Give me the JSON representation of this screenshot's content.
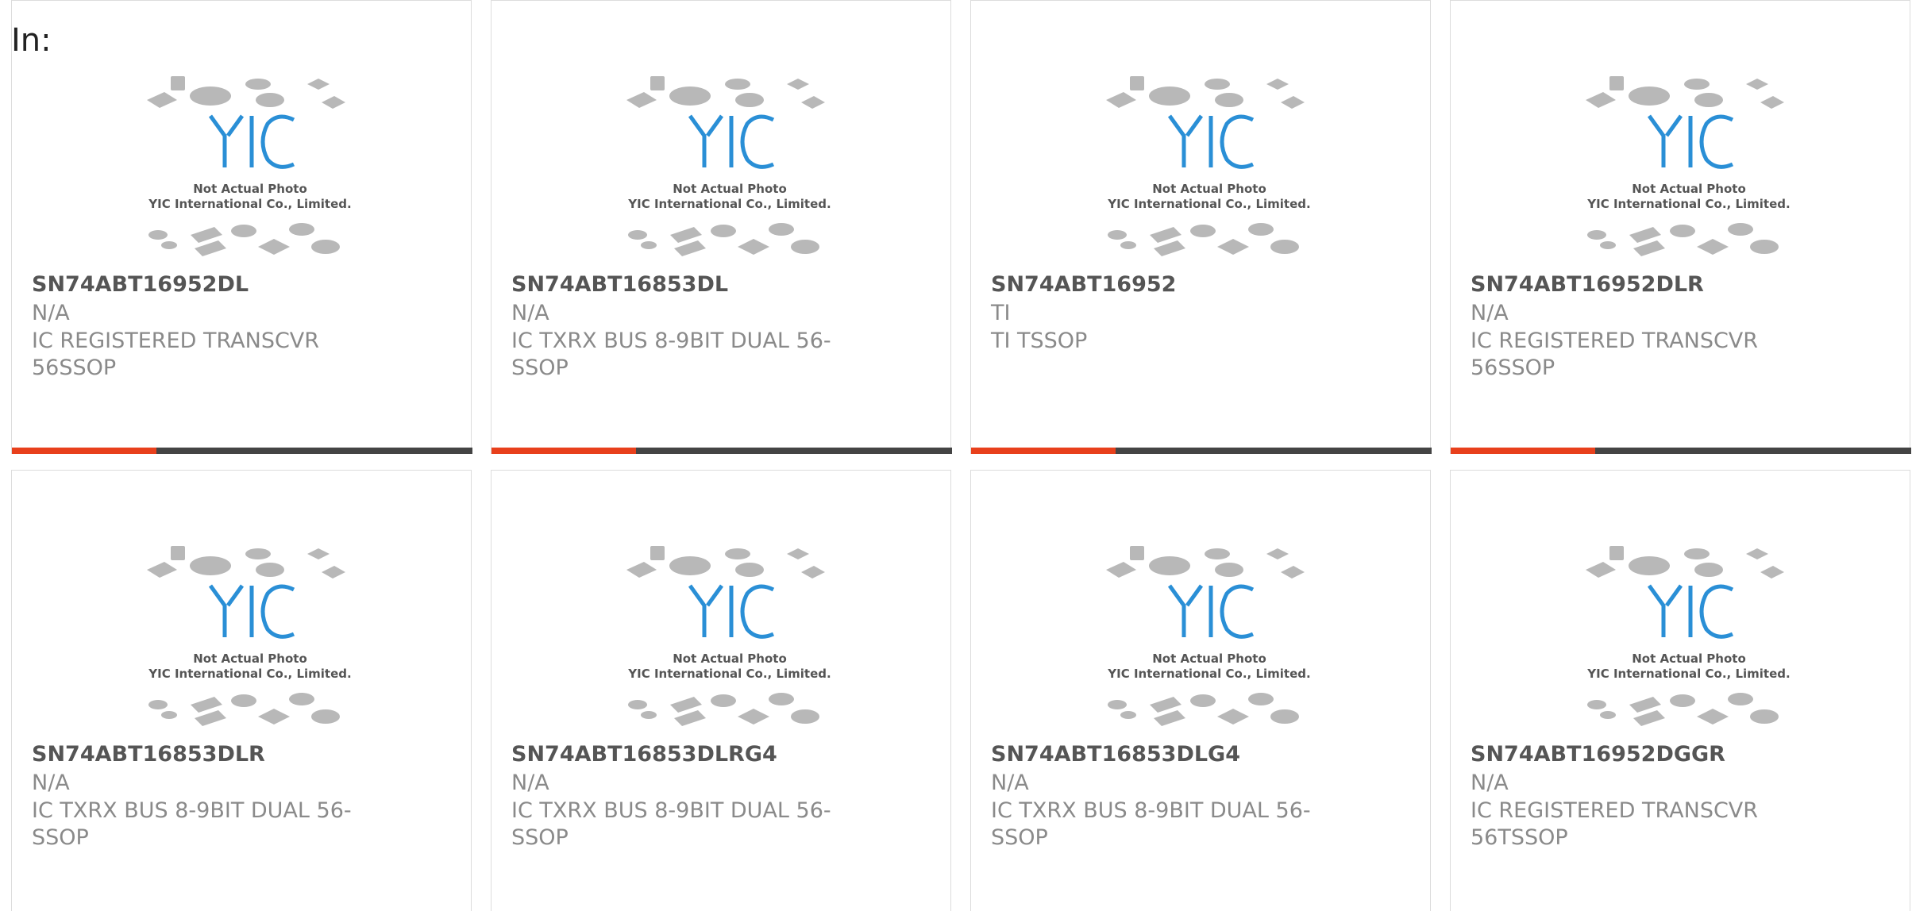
{
  "header": {
    "label": "In:"
  },
  "placeholder": {
    "line1": "Not Actual Photo",
    "line2": "YIC International Co., Limited.",
    "logo": "YIC"
  },
  "colors": {
    "accent": "#e8401c",
    "bar_dark": "#444444",
    "logo_blue": "#2a8fd6"
  },
  "products": [
    {
      "part_number": "SN74ABT16952DL",
      "manufacturer": "N/A",
      "description": "IC REGISTERED TRANSCVR 56SSOP"
    },
    {
      "part_number": "SN74ABT16853DL",
      "manufacturer": "N/A",
      "description": "IC TXRX BUS 8-9BIT DUAL 56-SSOP"
    },
    {
      "part_number": "SN74ABT16952",
      "manufacturer": "TI",
      "description": "TI TSSOP"
    },
    {
      "part_number": "SN74ABT16952DLR",
      "manufacturer": "N/A",
      "description": "IC REGISTERED TRANSCVR 56SSOP"
    },
    {
      "part_number": "SN74ABT16853DLR",
      "manufacturer": "N/A",
      "description": "IC TXRX BUS 8-9BIT DUAL 56-SSOP"
    },
    {
      "part_number": "SN74ABT16853DLRG4",
      "manufacturer": "N/A",
      "description": "IC TXRX BUS 8-9BIT DUAL 56-SSOP"
    },
    {
      "part_number": "SN74ABT16853DLG4",
      "manufacturer": "N/A",
      "description": "IC TXRX BUS 8-9BIT DUAL 56-SSOP"
    },
    {
      "part_number": "SN74ABT16952DGGR",
      "manufacturer": "N/A",
      "description": "IC REGISTERED TRANSCVR 56TSSOP"
    }
  ]
}
